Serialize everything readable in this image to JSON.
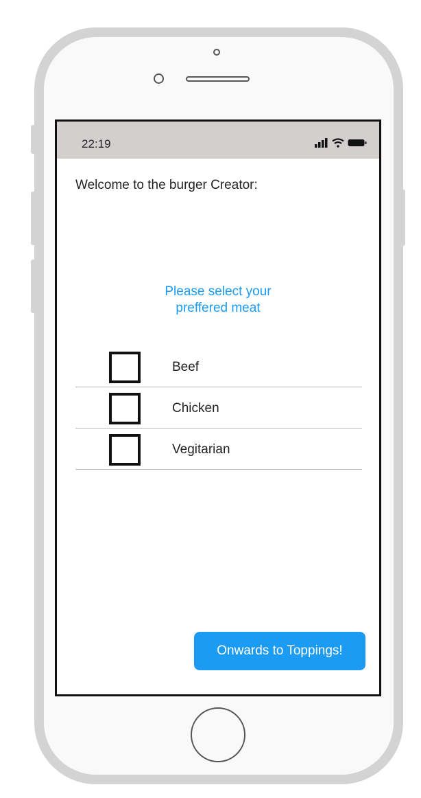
{
  "status_bar": {
    "time": "22:19",
    "icons": [
      "signal-icon",
      "wifi-icon",
      "battery-icon"
    ]
  },
  "header": {
    "welcome": "Welcome to the burger Creator:"
  },
  "prompt": {
    "line1": "Please select your",
    "line2": "preffered meat"
  },
  "options": [
    {
      "label": "Beef",
      "checked": false
    },
    {
      "label": "Chicken",
      "checked": false
    },
    {
      "label": "Vegitarian",
      "checked": false
    }
  ],
  "action": {
    "label": "Onwards to Toppings!"
  },
  "colors": {
    "accent": "#1b9cf2",
    "status_bar_bg": "#d3cfcf",
    "phone_frame": "#d3d3d3"
  }
}
